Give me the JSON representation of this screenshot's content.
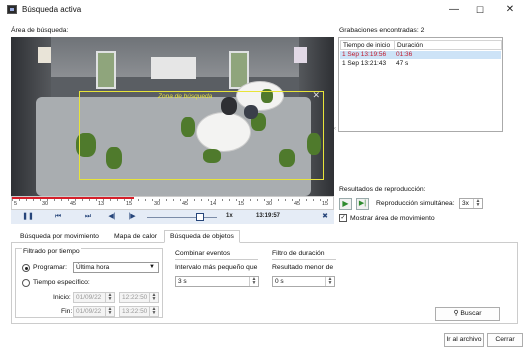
{
  "window": {
    "title": "Búsqueda activa",
    "minimize": "—",
    "maximize": "☐",
    "close": "✕"
  },
  "search_area": {
    "label": "Área de búsqueda:",
    "zone_label": "Zona de búsqueda",
    "zone_close": "✕"
  },
  "timeline": {
    "tick_labels": [
      "5",
      "30",
      "45",
      "13",
      "15",
      "30",
      "45",
      "14",
      "15",
      "30",
      "45",
      "15"
    ],
    "played_fraction": 0.38
  },
  "controls": {
    "pause": "❚❚",
    "prev": "⏮",
    "next": "⏭",
    "step_back": "◀|",
    "step_fwd": "|▶",
    "speed": "1x",
    "time": "13:19:57",
    "close": "✖"
  },
  "recordings": {
    "label": "Grabaciones encontradas: 2",
    "columns": [
      "Tiempo de inicio",
      "Duración"
    ],
    "rows": [
      {
        "start": "1 Sep 13:19:56",
        "duration": "01:36",
        "selected": true
      },
      {
        "start": "1 Sep 13:21:43",
        "duration": "47 s",
        "selected": false
      }
    ]
  },
  "playback": {
    "label": "Resultados de reproducción:",
    "simultaneous_label": "Reproducción simultánea:",
    "simultaneous_value": "3x",
    "show_area_label": "Mostrar área de movimiento",
    "show_area_checked": true
  },
  "tabs": [
    "Búsqueda por movimiento",
    "Mapa de calor",
    "Búsqueda de objetos"
  ],
  "active_tab": 2,
  "time_filter": {
    "title": "Filtrado por tiempo",
    "schedule_label": "Programar:",
    "schedule_value": "Última hora",
    "specific_label": "Tiempo específico:",
    "start_label": "Inicio:",
    "start_date": "01/09/22",
    "start_time": "12:22:50",
    "end_label": "Fin:",
    "end_date": "01/09/22",
    "end_time": "13:22:50"
  },
  "combine": {
    "title": "Combinar eventos",
    "interval_label": "Intervalo más pequeño que",
    "interval_value": "3 s"
  },
  "duration_filter": {
    "title": "Filtro de duración",
    "result_label": "Resultado menor de",
    "result_value": "0 s"
  },
  "buttons": {
    "search": "Buscar",
    "goto_file": "Ir al archivo",
    "close": "Cerrar"
  },
  "colors": {
    "zone": "#e8e43a",
    "selected_row_text": "#c0182b",
    "timeline_played": "#d61f2a",
    "control_bar": "#e5ecf6"
  }
}
